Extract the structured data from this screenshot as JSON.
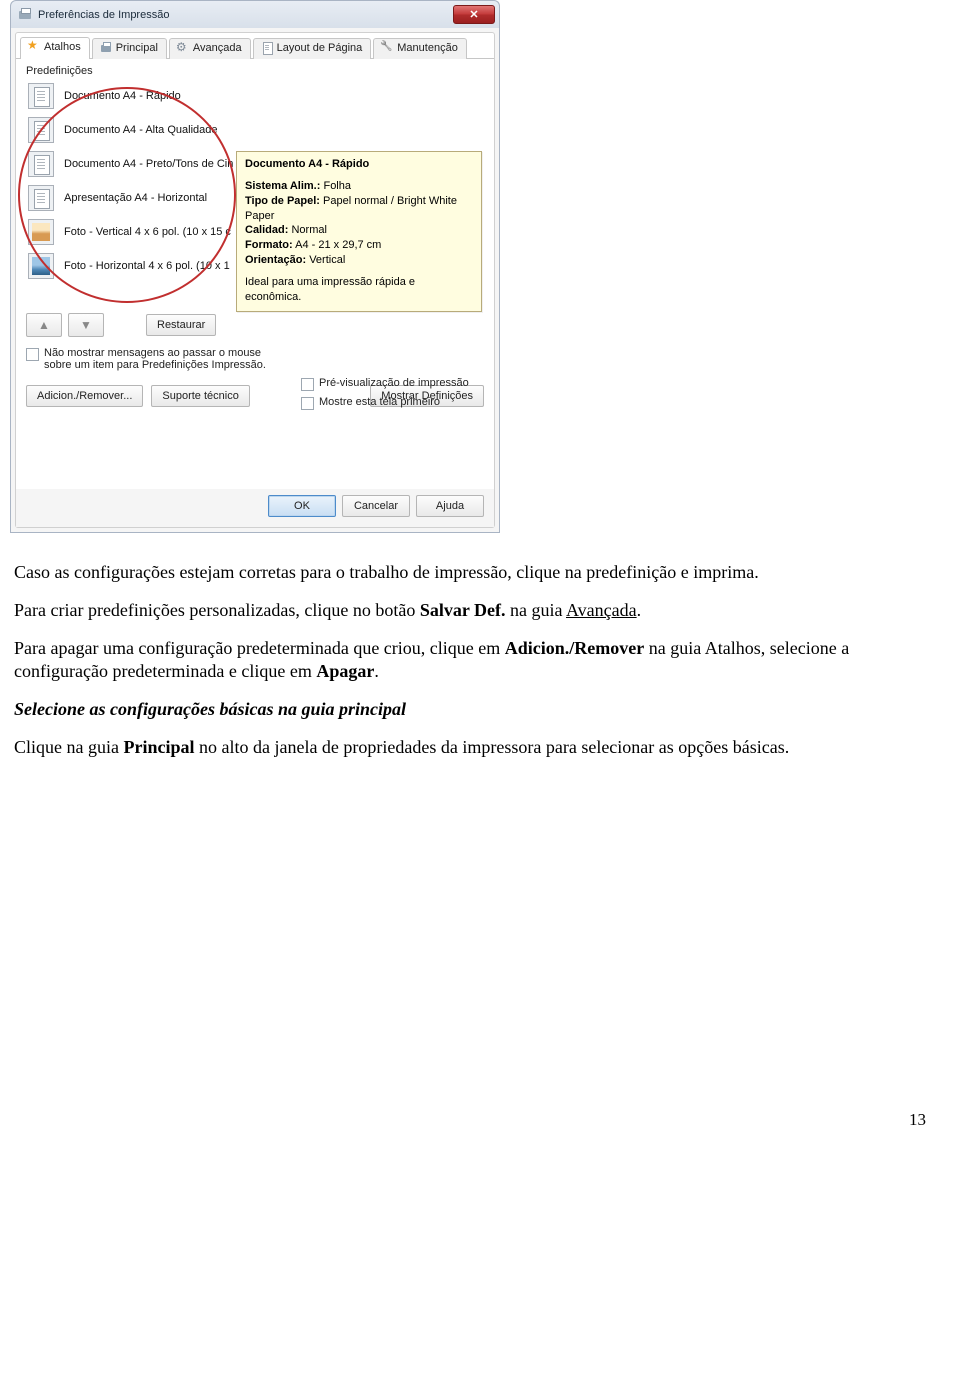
{
  "page_number": "13",
  "dialog": {
    "title": "Preferências de Impressão",
    "tabs": {
      "atalhos": "Atalhos",
      "principal": "Principal",
      "avancada": "Avançada",
      "layout": "Layout de Página",
      "manutencao": "Manutenção"
    },
    "presets_heading": "Predefinições",
    "presets": [
      "Documento A4 - Rápido",
      "Documento A4 - Alta Qualidade",
      "Documento A4 - Preto/Tons de Cin",
      "Apresentação A4 - Horizontal",
      "Foto - Vertical 4 x 6 pol. (10 x 15 c",
      "Foto - Horizontal 4 x 6 pol. (10 x 1"
    ],
    "tooltip": {
      "title": "Documento A4 - Rápido",
      "rows": [
        {
          "k": "Sistema Alim.:",
          "v": "Folha"
        },
        {
          "k": "Tipo de Papel:",
          "v": "Papel normal / Bright White Paper"
        },
        {
          "k": "Calidad:",
          "v": "Normal"
        },
        {
          "k": "Formato:",
          "v": "A4 - 21 x 29,7 cm"
        },
        {
          "k": "Orientação:",
          "v": "Vertical"
        }
      ],
      "desc": "Ideal para uma impressão rápida e econômica."
    },
    "restore_btn": "Restaurar",
    "chk_hide_msgs": "Não mostrar mensagens ao passar o mouse sobre um item para Predefinições Impressão.",
    "chk_preview": "Pré-visualização de impressão",
    "chk_show_first": "Mostre esta tela primeiro",
    "btn_add_remove": "Adicion./Remover...",
    "btn_support": "Suporte técnico",
    "btn_show_defs": "Mostrar Definições",
    "footer": {
      "ok": "OK",
      "cancel": "Cancelar",
      "help": "Ajuda"
    }
  },
  "doc": {
    "p1a": "Caso as configurações estejam corretas para o trabalho de impressão, clique na predefinição e imprima.",
    "p2a": "Para criar predefinições personalizadas, clique no botão ",
    "p2b": "Salvar Def.",
    "p2c": " na guia ",
    "p2d": "Avançada",
    "p2e": ".",
    "p3a": "Para apagar uma configuração predeterminada que criou, clique em ",
    "p3b": "Adicion./Remover",
    "p3c": " na guia Atalhos, selecione a configuração predeterminada e clique em ",
    "p3d": "Apagar",
    "p3e": ".",
    "subhead": "Selecione as configurações básicas na guia principal",
    "p4a": "Clique na guia ",
    "p4b": "Principal",
    "p4c": " no alto da janela de propriedades da impressora para selecionar as opções básicas."
  }
}
